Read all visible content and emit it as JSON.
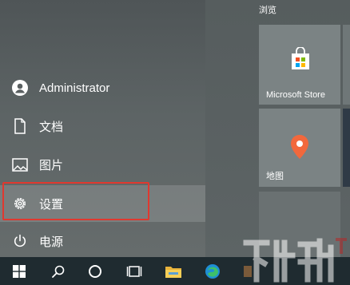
{
  "left_rail": {
    "items": [
      {
        "label": "Administrator",
        "icon": "user-icon"
      },
      {
        "label": "文档",
        "icon": "document-icon"
      },
      {
        "label": "图片",
        "icon": "pictures-icon"
      },
      {
        "label": "设置",
        "icon": "settings-gear-icon",
        "active": true
      },
      {
        "label": "电源",
        "icon": "power-icon"
      }
    ]
  },
  "tiles": {
    "section_label": "浏览",
    "store": {
      "label": "Microsoft Store",
      "icon": "store-bag-icon"
    },
    "maps": {
      "label": "地图",
      "icon": "map-pin-icon"
    }
  },
  "taskbar": {
    "items": [
      "windows-start-icon",
      "search-icon",
      "cortana-circle-icon",
      "task-view-icon",
      "file-explorer-icon",
      "edge-browser-icon"
    ]
  },
  "colors": {
    "highlight_border": "#e0382f",
    "taskbar_bg": "#1f2b30",
    "map_pin": "#f2683c"
  },
  "watermark": {
    "text": "下载吧"
  }
}
